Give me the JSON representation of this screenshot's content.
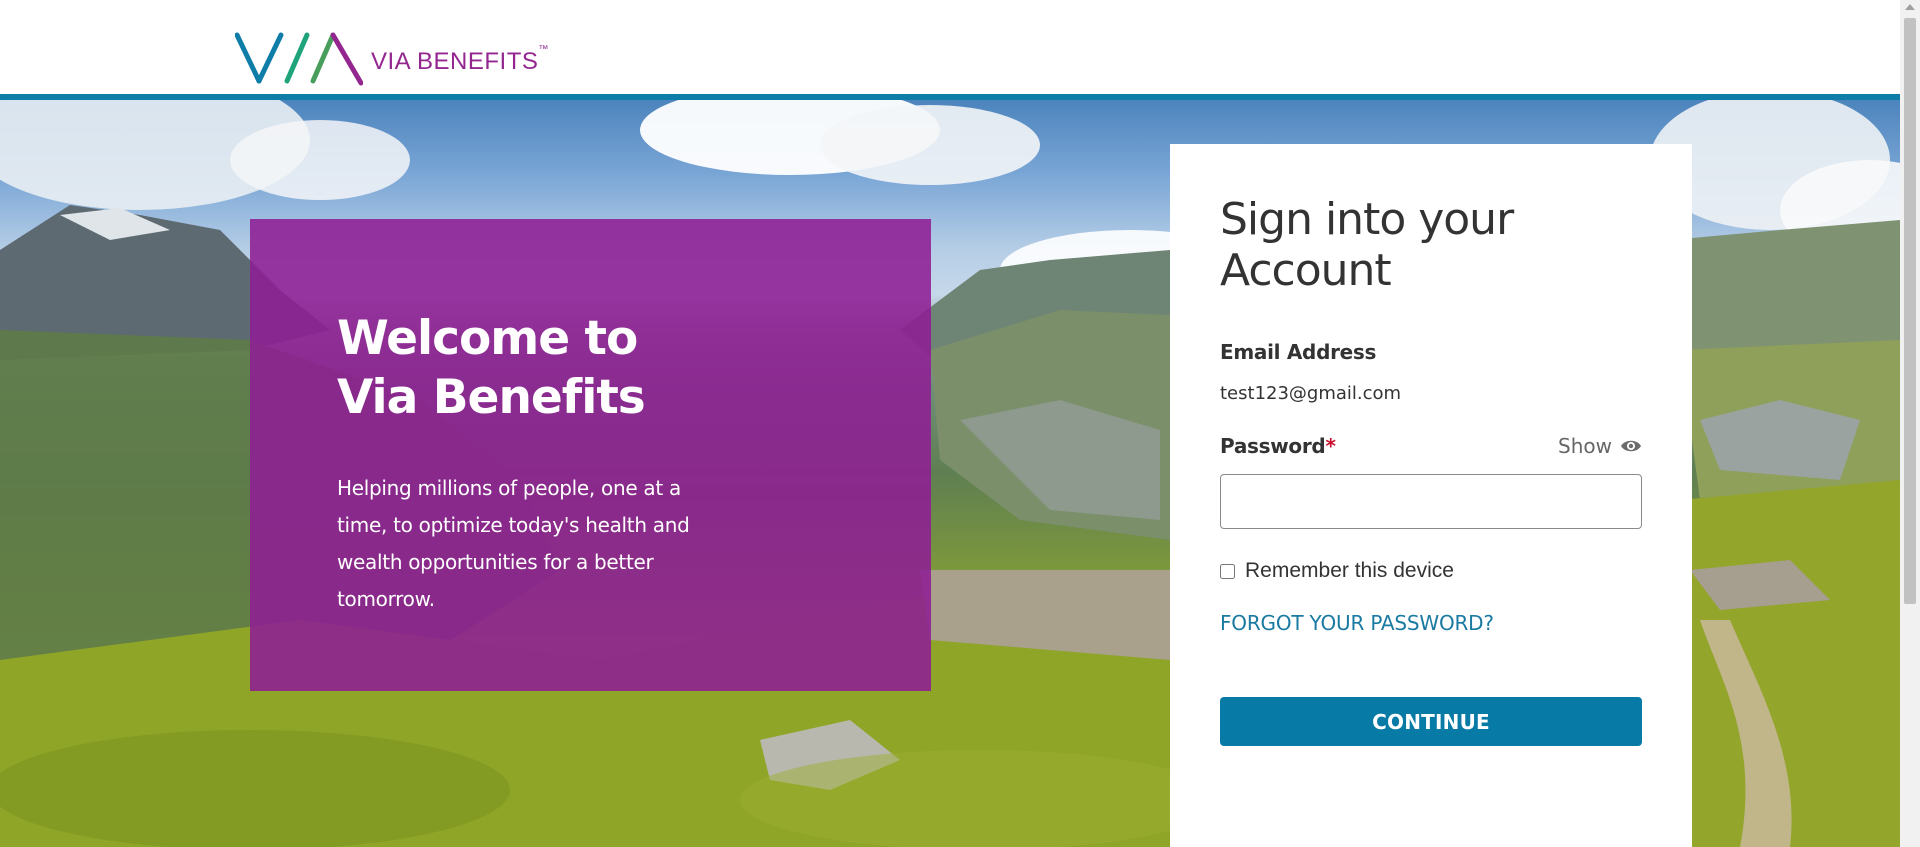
{
  "brand": {
    "name": "VIA BENEFITS",
    "tm": "™",
    "colors": {
      "teal": "#0e7da8",
      "purple": "#93278f",
      "button": "#077aa6",
      "link": "#1a7aa1",
      "required": "#c8102e"
    }
  },
  "welcome": {
    "title": "Welcome to Via Benefits",
    "body": "Helping millions of people, one at a time, to optimize today's health and wealth opportunities for a better tomorrow."
  },
  "signin": {
    "heading": "Sign into your Account",
    "email_label": "Email Address",
    "email_value": "test123@gmail.com",
    "password_label": "Password",
    "required_mark": "*",
    "show_label": "Show",
    "show_icon": "eye-icon",
    "password_value": "",
    "remember_label": "Remember this device",
    "remember_checked": false,
    "forgot_label": "FORGOT YOUR PASSWORD?",
    "continue_label": "CONTINUE"
  }
}
